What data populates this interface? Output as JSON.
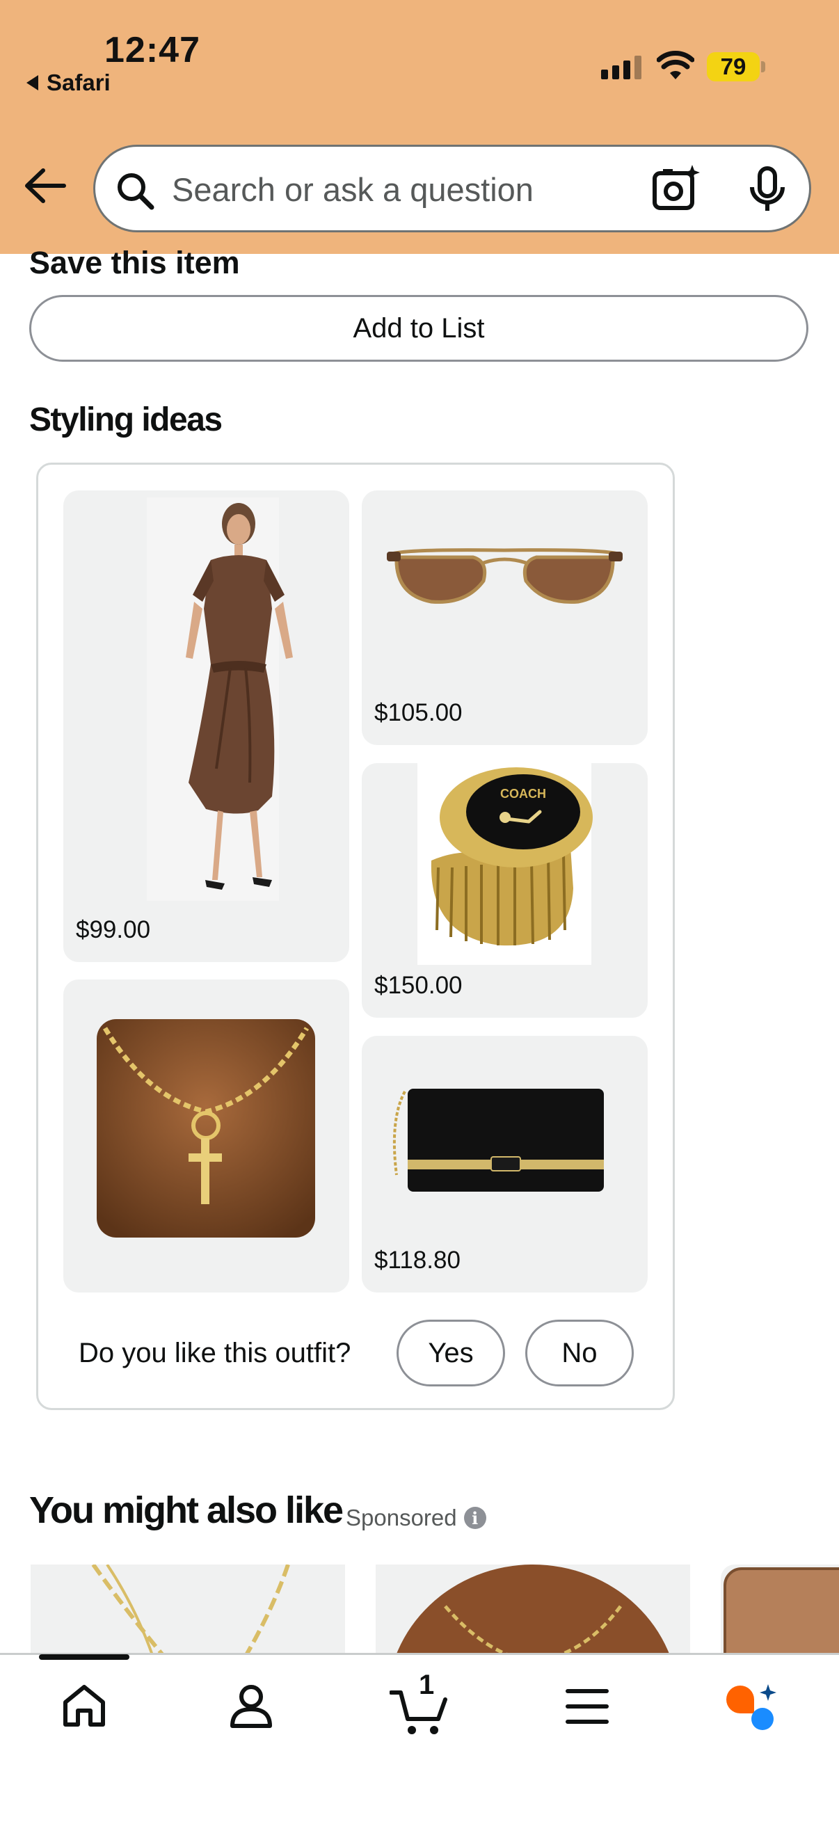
{
  "status_bar": {
    "time": "12:47",
    "back_app": "Safari",
    "battery": "79"
  },
  "search": {
    "placeholder": "Search or ask a question"
  },
  "save_item": {
    "title": "Save this item",
    "add_to_list_label": "Add to List"
  },
  "styling_ideas": {
    "title": "Styling ideas",
    "items": [
      {
        "name": "satin shirt dress",
        "price": "$99.00"
      },
      {
        "name": "oval sunglasses",
        "price": "$105.00"
      },
      {
        "name": "watch ring",
        "price": "$150.00"
      },
      {
        "name": "cross toggle necklace",
        "price": ""
      },
      {
        "name": "black clutch",
        "price": "$118.80"
      }
    ],
    "feedback_question": "Do you like this outfit?",
    "yes_label": "Yes",
    "no_label": "No"
  },
  "also_like": {
    "title": "You might also like",
    "sponsored": "Sponsored",
    "info_glyph": "i"
  },
  "bottom_nav": {
    "items": [
      "home-icon",
      "account-icon",
      "cart-icon",
      "menu-icon",
      "rufus-icon"
    ],
    "cart_count": "1"
  },
  "colors": {
    "header_bg": "#efb47c",
    "battery": "#f3d313",
    "tile_bg": "#f0f1f1",
    "border": "#d5d9d9",
    "rufus_orange": "#ff6200",
    "rufus_blue": "#1a8cff"
  }
}
